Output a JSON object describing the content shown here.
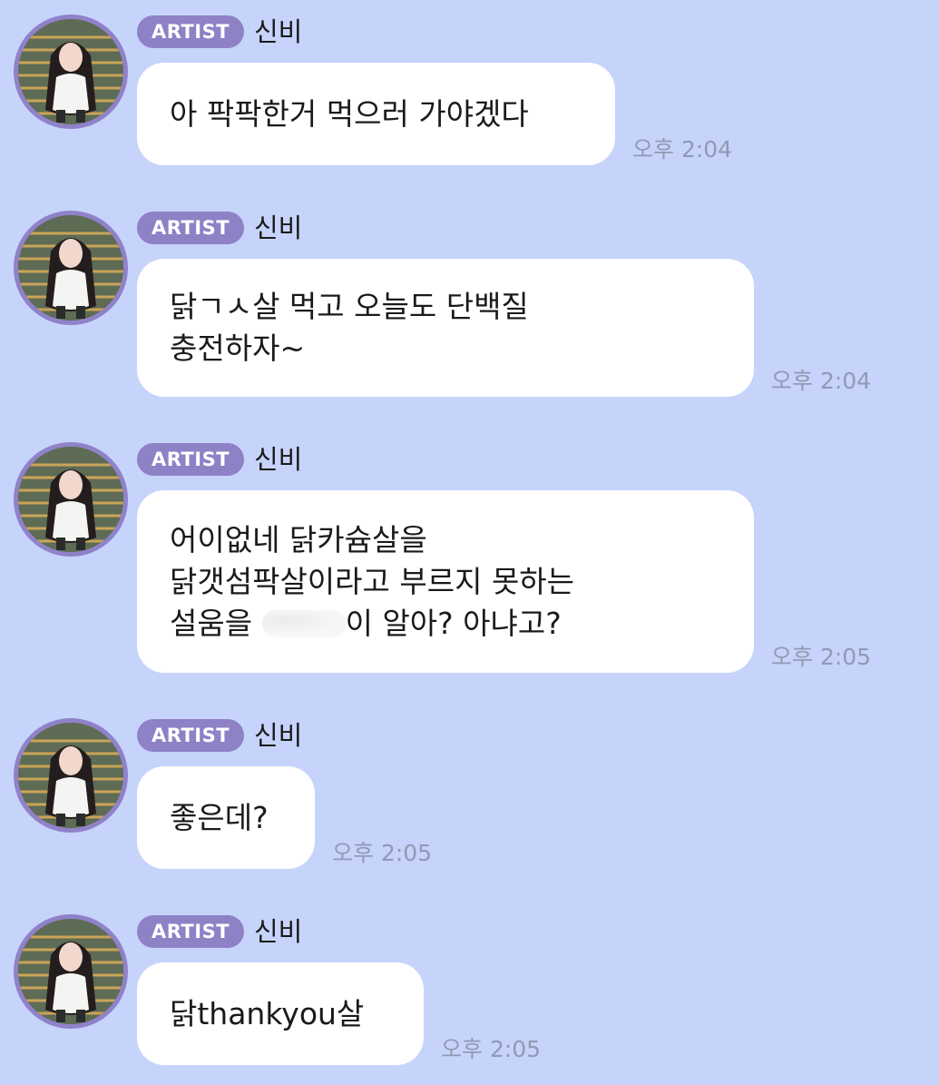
{
  "messages": [
    {
      "badge": "ARTIST",
      "name": "신비",
      "lines": [
        "아 팍팍한거 먹으러 가야겠다"
      ],
      "time": "오후 2:04"
    },
    {
      "badge": "ARTIST",
      "name": "신비",
      "lines": [
        "닭ㄱㅅ살 먹고 오늘도 단백질",
        "충전하자~"
      ],
      "time": "오후 2:04"
    },
    {
      "badge": "ARTIST",
      "name": "신비",
      "lines": [
        "어이없네 닭카슘살을",
        "닭갯섬팍살이라고 부르지 못하는",
        "설움을",
        "이 알아? 아냐고?"
      ],
      "time": "오후 2:05"
    },
    {
      "badge": "ARTIST",
      "name": "신비",
      "lines": [
        "좋은데?"
      ],
      "time": "오후 2:05"
    },
    {
      "badge": "ARTIST",
      "name": "신비",
      "lines": [
        "닭thankyou살"
      ],
      "time": "오후 2:05"
    }
  ]
}
